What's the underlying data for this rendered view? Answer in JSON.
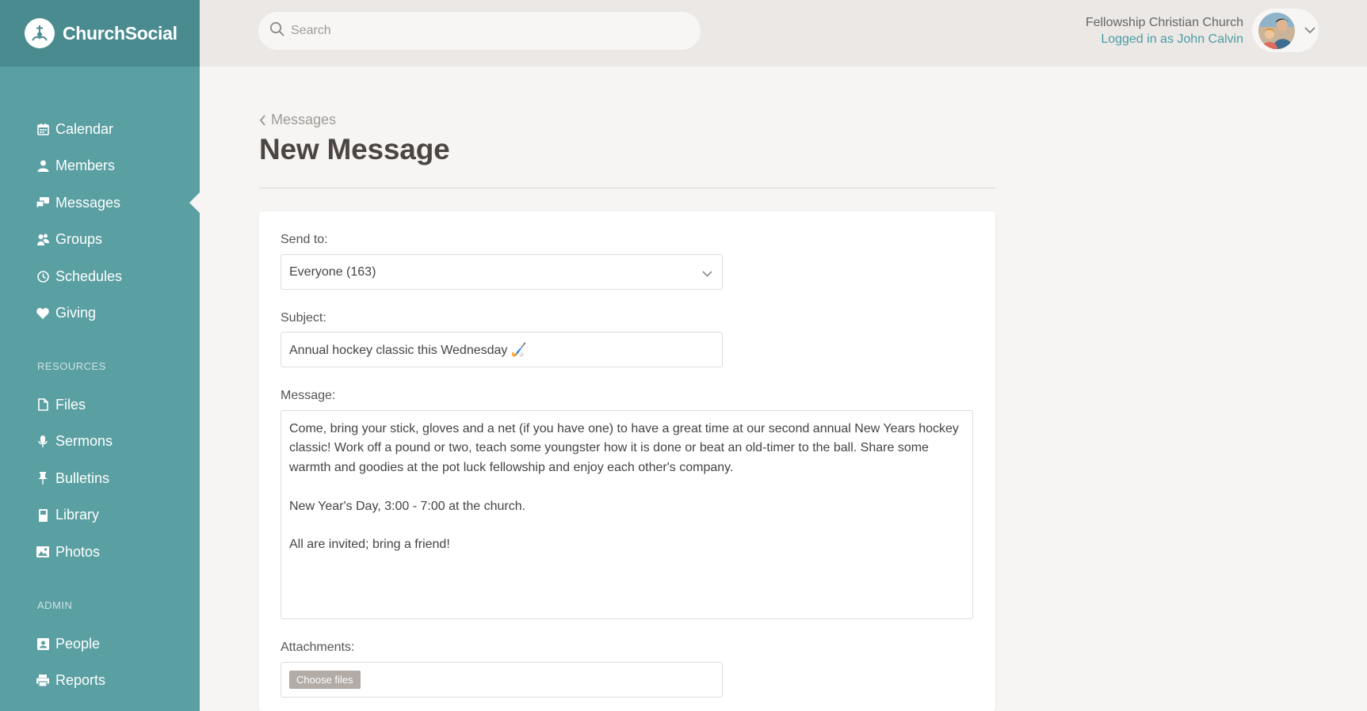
{
  "brand": {
    "name": "ChurchSocial"
  },
  "search": {
    "placeholder": "Search"
  },
  "user": {
    "church": "Fellowship Christian Church",
    "logged_in": "Logged in as John Calvin"
  },
  "nav": {
    "main": [
      {
        "label": "Calendar",
        "icon": "calendar-icon"
      },
      {
        "label": "Members",
        "icon": "person-icon"
      },
      {
        "label": "Messages",
        "icon": "chat-icon",
        "active": true
      },
      {
        "label": "Groups",
        "icon": "groups-icon"
      },
      {
        "label": "Schedules",
        "icon": "clock-icon"
      },
      {
        "label": "Giving",
        "icon": "heart-icon"
      }
    ],
    "resources_label": "RESOURCES",
    "resources": [
      {
        "label": "Files",
        "icon": "file-icon"
      },
      {
        "label": "Sermons",
        "icon": "microphone-icon"
      },
      {
        "label": "Bulletins",
        "icon": "pin-icon"
      },
      {
        "label": "Library",
        "icon": "book-icon"
      },
      {
        "label": "Photos",
        "icon": "image-icon"
      }
    ],
    "admin_label": "ADMIN",
    "admin": [
      {
        "label": "People",
        "icon": "id-card-icon"
      },
      {
        "label": "Reports",
        "icon": "printer-icon"
      }
    ]
  },
  "page": {
    "breadcrumb": "Messages",
    "title": "New Message"
  },
  "form": {
    "send_to_label": "Send to:",
    "send_to_value": "Everyone (163)",
    "subject_label": "Subject:",
    "subject_value": "Annual hockey classic this Wednesday 🏑",
    "message_label": "Message:",
    "message_value": "Come, bring your stick, gloves and a net (if you have one) to have a great time at our second annual New Years hockey classic! Work off a pound or two, teach some youngster how it is done or beat an old-timer to the ball. Share some warmth and goodies at the pot luck fellowship and enjoy each other's company.\n\nNew Year's Day, 3:00 - 7:00 at the church.\n\nAll are invited; bring a friend!",
    "attachments_label": "Attachments:",
    "choose_files_label": "Choose files"
  },
  "colors": {
    "sidebar": "#5a9fa2",
    "sidebar_header": "#4a8b8f",
    "accent_link": "#4a9da3",
    "topbar": "#ebe8e6",
    "background": "#f6f5f3"
  }
}
